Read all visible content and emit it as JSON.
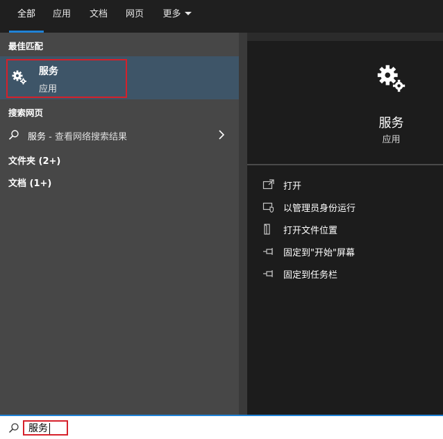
{
  "tabs": [
    {
      "label": "全部",
      "active": true
    },
    {
      "label": "应用",
      "active": false
    },
    {
      "label": "文档",
      "active": false
    },
    {
      "label": "网页",
      "active": false
    },
    {
      "label": "更多",
      "active": false
    }
  ],
  "sections": {
    "best_match": "最佳匹配",
    "search_web": "搜索网页"
  },
  "best_match": {
    "title": "服务",
    "subtitle": "应用",
    "icon": "gear-icon"
  },
  "web_result": {
    "query": "服务",
    "suffix": " - 查看网络搜索结果"
  },
  "groups": {
    "folders": "文件夹 (2+)",
    "documents": "文档 (1+)"
  },
  "detail": {
    "title": "服务",
    "subtitle": "应用",
    "actions": [
      {
        "label": "打开",
        "icon": "open-icon"
      },
      {
        "label": "以管理员身份运行",
        "icon": "run-as-admin-icon"
      },
      {
        "label": "打开文件位置",
        "icon": "file-location-icon"
      },
      {
        "label": "固定到\"开始\"屏幕",
        "icon": "pin-icon"
      },
      {
        "label": "固定到任务栏",
        "icon": "pin-icon"
      }
    ]
  },
  "search": {
    "query": "服务"
  },
  "colors": {
    "accent": "#1f82d6",
    "highlight": "#d6202a",
    "selected_row": "#3e5568"
  }
}
